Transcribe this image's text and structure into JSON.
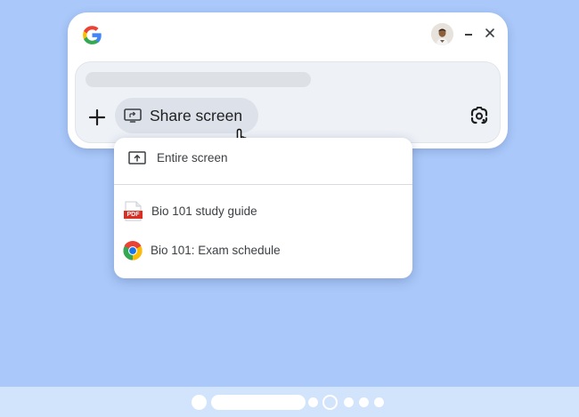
{
  "colors": {
    "background": "#aac8fa",
    "window": "#ffffff",
    "input_box": "#eef1f6",
    "share_chip": "#dde2ea",
    "taskbar": "#d2e3fc",
    "pdf_red": "#d93025"
  },
  "header": {
    "logo_icon": "google-g-logo",
    "avatar_icon": "user-avatar",
    "minimize_icon": "minimize-icon",
    "close_icon": "close-icon"
  },
  "input": {
    "add_icon": "plus-icon",
    "share_button": {
      "label": "Share screen",
      "icon": "share-screen-icon"
    },
    "lens_icon": "google-lens-icon"
  },
  "menu": {
    "items": [
      {
        "label": "Entire screen",
        "icon": "screen-upload-icon"
      },
      {
        "label": "Bio 101 study guide",
        "icon": "pdf-file-icon",
        "icon_text": "PDF"
      },
      {
        "label": "Bio 101: Exam schedule",
        "icon": "chrome-icon"
      }
    ]
  },
  "taskbar": {
    "icons": [
      "launcher-dot",
      "search-pill",
      "shelf-dot",
      "active-app-ring",
      "shelf-dot",
      "shelf-dot",
      "shelf-dot"
    ]
  }
}
